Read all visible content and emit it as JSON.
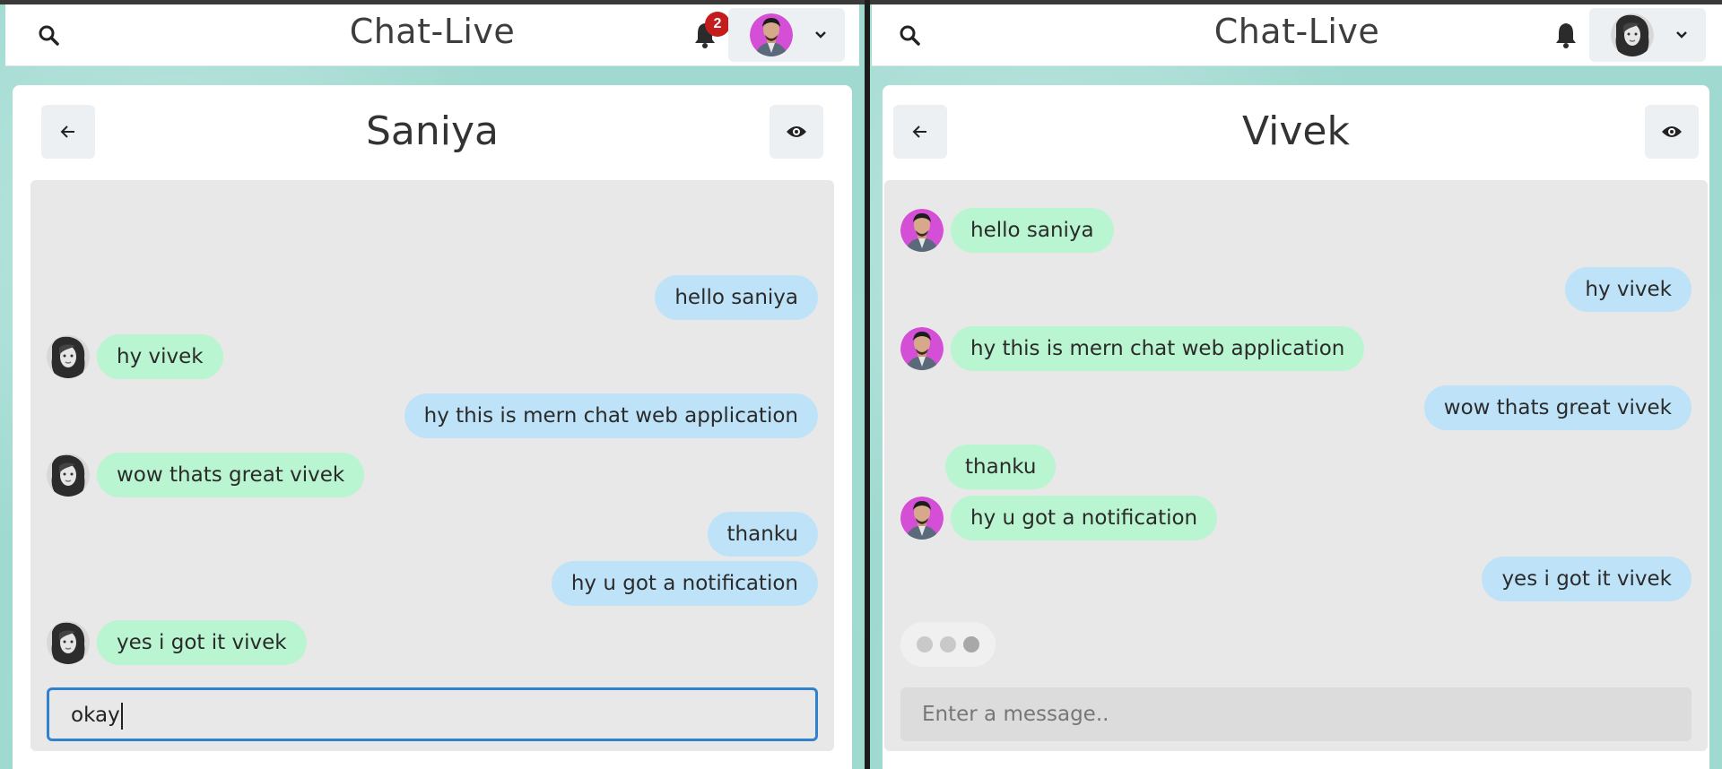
{
  "colors": {
    "accent": "#3182ce",
    "sent_bubble": "#bee3f8",
    "received_bubble": "#b9f5d0",
    "badge": "#c41d1d"
  },
  "left_window": {
    "header": {
      "title": "Chat-Live",
      "notification_count": "2"
    },
    "chat": {
      "contact_name": "Saniya",
      "messages": [
        {
          "dir": "sent",
          "text": "hello saniya"
        },
        {
          "dir": "recv",
          "text": "hy vivek"
        },
        {
          "dir": "sent",
          "text": "hy this is mern chat web application"
        },
        {
          "dir": "recv",
          "text": "wow thats great vivek"
        },
        {
          "dir": "sent",
          "text": "thanku"
        },
        {
          "dir": "sent",
          "text": "hy u got a notification"
        },
        {
          "dir": "recv",
          "text": "yes i got it vivek"
        }
      ],
      "input_value": "okay"
    }
  },
  "right_window": {
    "header": {
      "title": "Chat-Live"
    },
    "chat": {
      "contact_name": "Vivek",
      "messages": [
        {
          "dir": "recv",
          "text": "hello saniya"
        },
        {
          "dir": "sent",
          "text": "hy vivek"
        },
        {
          "dir": "recv",
          "text": "hy this is mern chat web application"
        },
        {
          "dir": "sent",
          "text": "wow thats great vivek"
        },
        {
          "dir": "recv",
          "text": "thanku"
        },
        {
          "dir": "recv",
          "text": "hy u got a notification"
        },
        {
          "dir": "sent",
          "text": "yes i got it vivek"
        }
      ],
      "typing_indicator": true,
      "input_placeholder": "Enter a message.."
    }
  },
  "icons": {
    "search": "search-icon",
    "bell": "bell-icon",
    "chevron": "chevron-down-icon",
    "back": "arrow-left-icon",
    "view": "eye-icon"
  }
}
